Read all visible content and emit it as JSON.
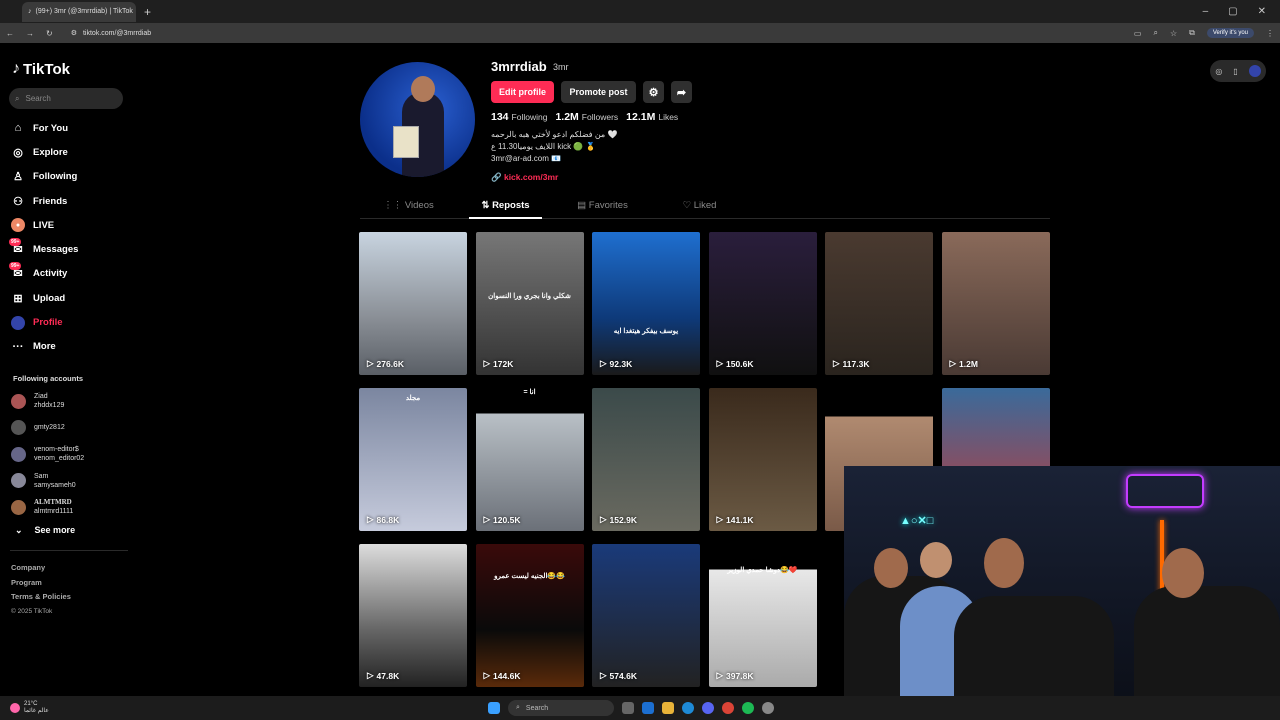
{
  "browser": {
    "tab_title": "(99+) 3mr (@3mrrdiab) | TikTok",
    "tab_close": "✕",
    "new_tab": "+",
    "url": "tiktok.com/@3mrrdiab",
    "verify_label": "Verify it's you"
  },
  "sidebar": {
    "logo": "TikTok",
    "search_placeholder": "Search",
    "nav": [
      {
        "label": "For You",
        "icon": "home-icon"
      },
      {
        "label": "Explore",
        "icon": "compass-icon"
      },
      {
        "label": "Following",
        "icon": "user-follow-icon"
      },
      {
        "label": "Friends",
        "icon": "friends-icon"
      },
      {
        "label": "LIVE",
        "icon": "live-icon"
      },
      {
        "label": "Messages",
        "icon": "messages-icon",
        "badge": "99+"
      },
      {
        "label": "Activity",
        "icon": "activity-icon",
        "badge": "99+"
      },
      {
        "label": "Upload",
        "icon": "upload-icon"
      },
      {
        "label": "Profile",
        "icon": "profile-avatar-icon"
      },
      {
        "label": "More",
        "icon": "more-icon"
      }
    ],
    "following_title": "Following accounts",
    "accounts": [
      {
        "name": "Ziad",
        "handle": "zhddx129"
      },
      {
        "name": "",
        "handle": "gmty2812"
      },
      {
        "name": "venom-editor$",
        "handle": "venom_editor02"
      },
      {
        "name": "Sam",
        "handle": "samysameh0"
      },
      {
        "name": "ALMTMRD",
        "handle": "almtmrd1111"
      }
    ],
    "see_more": "See more",
    "footer": [
      "Company",
      "Program",
      "Terms & Policies"
    ],
    "copyright": "© 2025 TikTok"
  },
  "profile": {
    "username": "3mrrdiab",
    "nickname": "3mr",
    "edit_button": "Edit profile",
    "promote_button": "Promote post",
    "following_count": "134",
    "following_label": "Following",
    "followers_count": "1.2M",
    "followers_label": "Followers",
    "likes_count": "12.1M",
    "likes_label": "Likes",
    "bio_line1": "من فضلكم ادعو لأختي هبه بالرحمه 🤍",
    "bio_line2": "اللايف يوميا11.30 ع kick 🟢 🥇",
    "bio_line3": "3mr@ar-ad.com 📧",
    "link": "kick.com/3mr"
  },
  "tabs": [
    "Videos",
    "Reposts",
    "Favorites",
    "Liked"
  ],
  "videos": [
    {
      "views": "276.6K",
      "caption": ""
    },
    {
      "views": "172K",
      "caption": "شكلي وانا بجري ورا النسوان"
    },
    {
      "views": "92.3K",
      "caption": "يوسف بيفكر هيتغدا ايه"
    },
    {
      "views": "150.6K",
      "caption": ""
    },
    {
      "views": "117.3K",
      "caption": ""
    },
    {
      "views": "1.2M",
      "caption": ""
    },
    {
      "views": "86.8K",
      "caption": "مجلد"
    },
    {
      "views": "120.5K",
      "caption": "= انا"
    },
    {
      "views": "152.9K",
      "caption": ""
    },
    {
      "views": "141.1K",
      "caption": ""
    },
    {
      "views": "",
      "caption": ""
    },
    {
      "views": "",
      "caption": ""
    },
    {
      "views": "47.8K",
      "caption": ""
    },
    {
      "views": "144.6K",
      "caption": "الجنيه ليست عمرو😂😂"
    },
    {
      "views": "574.6K",
      "caption": ""
    },
    {
      "views": "397.8K",
      "caption": "دوشا حمدي الوزير😂❤️"
    }
  ],
  "taskbar": {
    "temp": "21°C",
    "weather_text": "عالم غائما",
    "search_label": "Search"
  },
  "colors": {
    "accent": "#fe2c55",
    "background": "#000000",
    "panel": "#2f2f2f"
  }
}
